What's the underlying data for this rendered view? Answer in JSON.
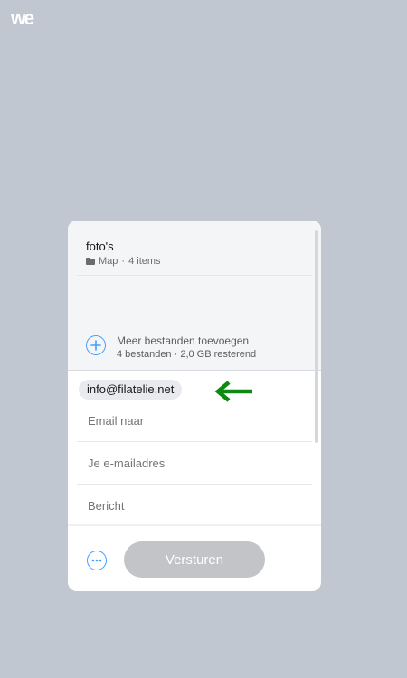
{
  "app": {
    "logo_icon": "wetransfer-logo",
    "background_color": "#c0c7d0",
    "accent_color": "#409fff"
  },
  "transfer": {
    "folder_name": "foto's",
    "folder_type": "Map",
    "separator": "·",
    "item_count": "4 items",
    "add_more_label": "Meer bestanden toevoegen",
    "summary": "4 bestanden · 2,0 GB resterend"
  },
  "form": {
    "recipient_chip": "info@filatelie.net",
    "email_to_placeholder": "Email naar",
    "your_email_placeholder": "Je e-mailadres",
    "message_placeholder": "Bericht"
  },
  "footer": {
    "send_label": "Versturen",
    "more_icon": "ellipsis-icon"
  },
  "annotation": {
    "arrow_color": "#0e8a12"
  }
}
